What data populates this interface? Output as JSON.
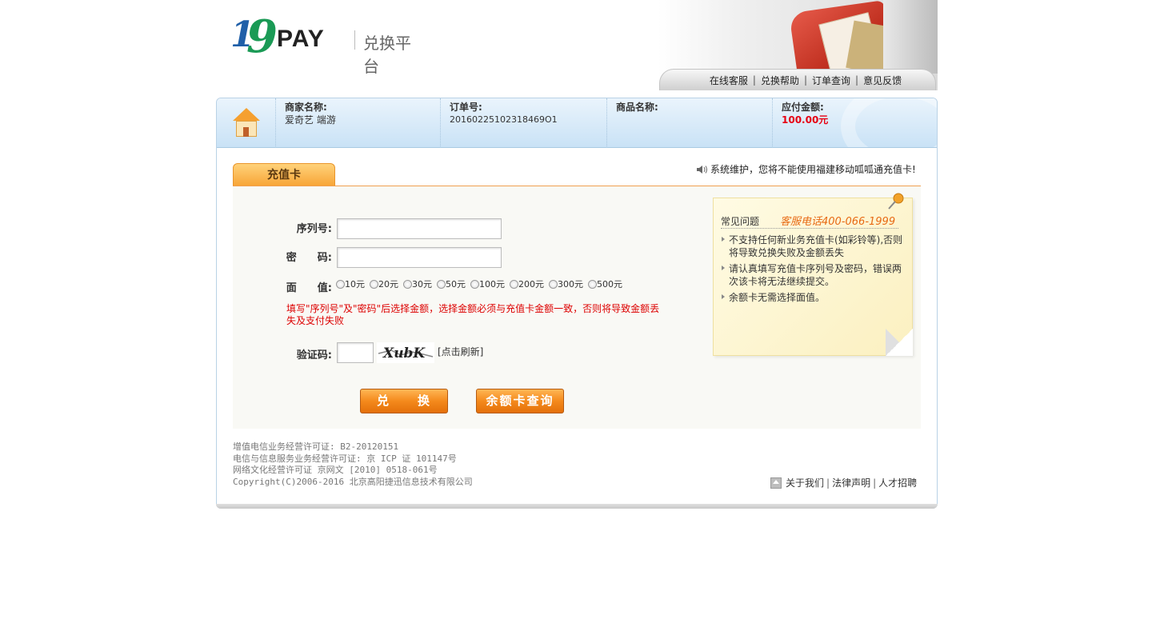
{
  "header": {
    "logo_one": "1",
    "logo_nine": "9",
    "logo_pay": "PAY",
    "logo_subtitle": "兑换平台",
    "nav": [
      {
        "label": "在线客服"
      },
      {
        "label": "兑换帮助"
      },
      {
        "label": "订单查询"
      },
      {
        "label": "意见反馈"
      }
    ],
    "nav_separator": "|"
  },
  "order_info": {
    "merchant_label": "商家名称:",
    "merchant_value": "爱奇艺 端游",
    "order_label": "订单号:",
    "order_value": "20160225102318469O1",
    "product_label": "商品名称:",
    "product_value": "",
    "amount_label": "应付金额:",
    "amount_value": "100.00元"
  },
  "tab": {
    "label": "充值卡"
  },
  "notice": {
    "text": "系统维护，您将不能使用福建移动呱呱通充值卡!"
  },
  "form": {
    "serial_label": "序列号:",
    "serial_value": "",
    "password_label": "密　　码:",
    "password_value": "",
    "denomination_label": "面　　值:",
    "denominations": [
      {
        "label": "10元"
      },
      {
        "label": "20元"
      },
      {
        "label": "30元"
      },
      {
        "label": "50元"
      },
      {
        "label": "100元"
      },
      {
        "label": "200元"
      },
      {
        "label": "300元"
      },
      {
        "label": "500元"
      }
    ],
    "warning": "填写\"序列号\"及\"密码\"后选择金额，选择金额必须与充值卡金额一致，否则将导致金额丢失及支付失败",
    "captcha_label": "验证码:",
    "captcha_value": "",
    "captcha_text": "XubK",
    "refresh_label": "[点击刷新]",
    "submit_label": "兑　　换",
    "balance_label": "余额卡查询"
  },
  "faq": {
    "title": "常见问题",
    "hotline": "客服电话400-066-1999",
    "items": [
      {
        "text": "不支持任何新业务充值卡(如彩铃等),否则将导致兑换失败及金额丢失"
      },
      {
        "text": "请认真填写充值卡序列号及密码，错误两次该卡将无法继续提交。"
      },
      {
        "text": "余额卡无需选择面值。"
      }
    ]
  },
  "footer": {
    "license_lines": [
      "增值电信业务经营许可证: B2-20120151",
      "电信与信息服务业务经营许可证: 京 ICP 证 101147号",
      "网络文化经营许可证 京网文 [2010] 0518-061号",
      "Copyright(C)2006-2016 北京高阳捷迅信息技术有限公司"
    ],
    "links": [
      {
        "label": "关于我们"
      },
      {
        "label": "法律声明"
      },
      {
        "label": "人才招聘"
      }
    ],
    "link_separator": "|"
  },
  "colors": {
    "accent_orange": "#f48a1c",
    "price_red": "#e60012",
    "warning_red": "#dd0000",
    "hotline_orange": "#e86a14",
    "info_blue": "#c9e2f6"
  },
  "icons": [
    "home-icon",
    "speaker-icon",
    "pin-icon",
    "house-icon"
  ]
}
